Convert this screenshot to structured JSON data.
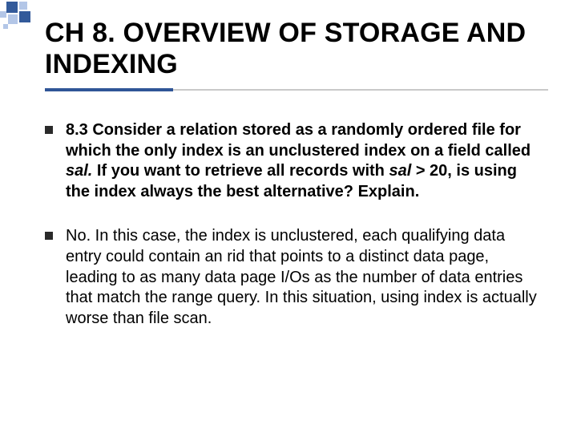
{
  "title": "CH 8. OVERVIEW OF STORAGE AND INDEXING",
  "bullets": [
    {
      "bold": true,
      "pre": "8.3 Consider a relation stored as a randomly ordered file for which the only index is an unclustered index on a field called ",
      "ital1": "sal.",
      "mid": " If you want to retrieve all records with ",
      "ital2": "sal",
      "post": " > 20, is using the index always the best alternative? Explain."
    },
    {
      "bold": false,
      "text": "No. In this case, the index is unclustered, each qualifying data entry could contain an rid that points to a distinct data page, leading to as many data page I/Os as the number of data entries that match the range query. In this situation, using index is actually worse than file scan."
    }
  ]
}
